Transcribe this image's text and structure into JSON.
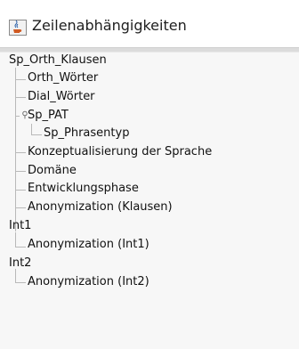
{
  "window": {
    "title": "Zeilenabhängigkeiten",
    "icon": "java-cup-icon"
  },
  "tree": {
    "roots": [
      {
        "label": "Sp_Orth_Klausen",
        "children": [
          {
            "label": "Orth_Wörter"
          },
          {
            "label": "Dial_Wörter"
          },
          {
            "label": "Sp_PAT",
            "expanded": true,
            "children": [
              {
                "label": "Sp_Phrasentyp"
              }
            ]
          },
          {
            "label": "Konzeptualisierung der Sprache"
          },
          {
            "label": "Domäne"
          },
          {
            "label": "Entwicklungsphase"
          },
          {
            "label": "Anonymization (Klausen)"
          }
        ]
      },
      {
        "label": "Int1",
        "children": [
          {
            "label": "Anonymization (Int1)"
          }
        ]
      },
      {
        "label": "Int2",
        "children": [
          {
            "label": "Anonymization (Int2)"
          }
        ]
      }
    ]
  }
}
